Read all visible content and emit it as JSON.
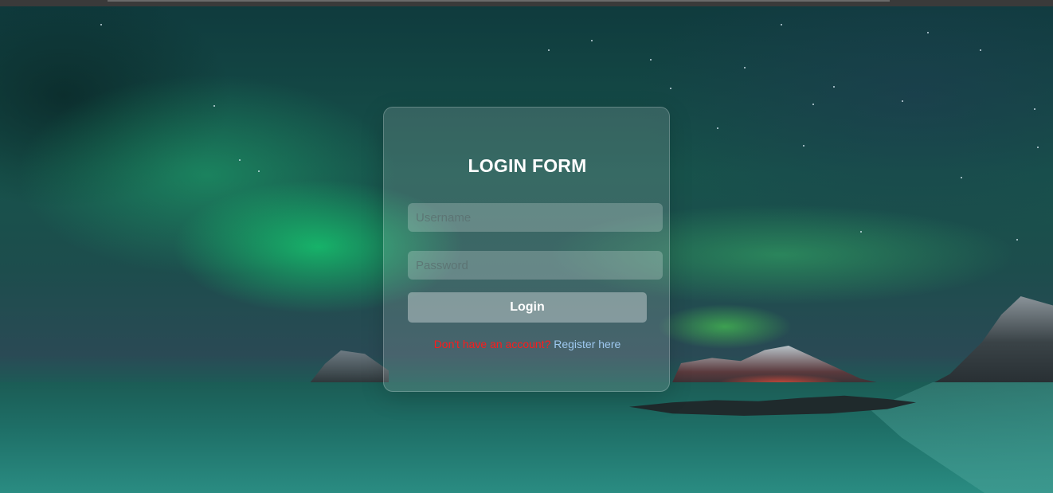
{
  "form": {
    "title": "LOGIN FORM",
    "username_placeholder": "Username",
    "password_placeholder": "Password",
    "login_label": "Login",
    "register_prompt": "Don't have an account?",
    "register_link": "Register here"
  },
  "colors": {
    "register_prompt": "#ff1a1a",
    "register_link": "#9ec9f0",
    "title": "#ffffff"
  }
}
